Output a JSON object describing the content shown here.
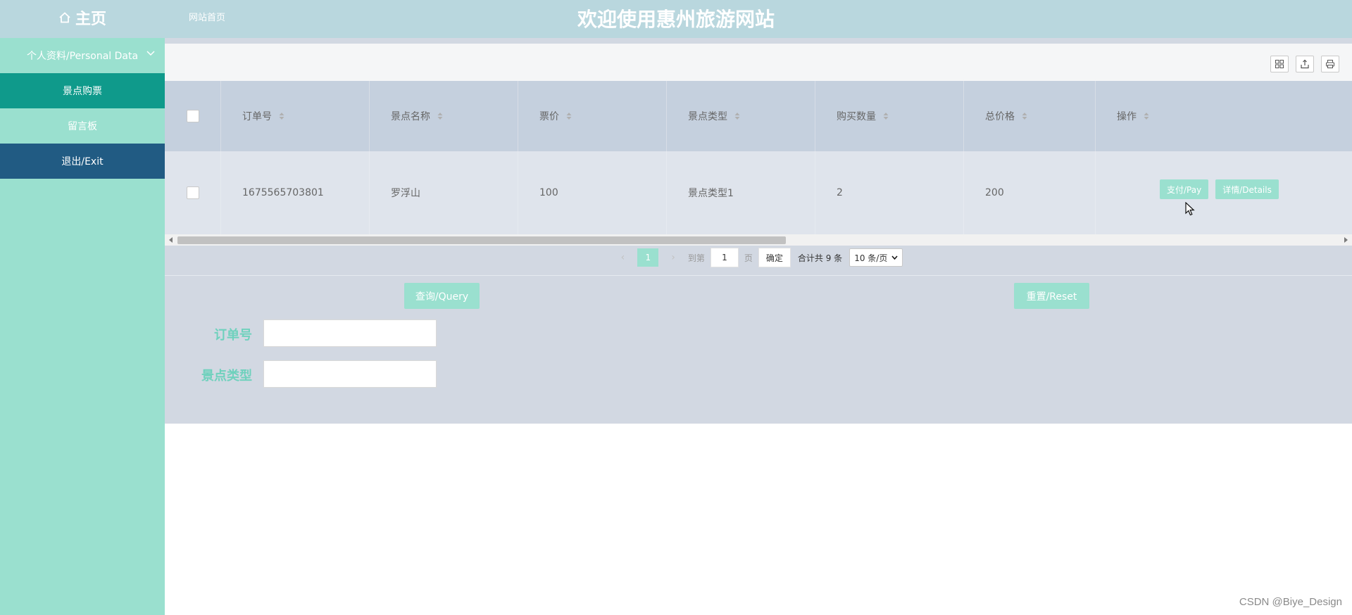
{
  "header": {
    "home_label": "主页",
    "site_link": "网站首页",
    "title": "欢迎使用惠州旅游网站"
  },
  "sidebar": {
    "items": [
      {
        "label": "个人资料/Personal Data"
      },
      {
        "label": "景点购票"
      },
      {
        "label": "留言板"
      },
      {
        "label": "退出/Exit"
      }
    ]
  },
  "table": {
    "columns": [
      "订单号",
      "景点名称",
      "票价",
      "景点类型",
      "购买数量",
      "总价格",
      "操作"
    ],
    "rows": [
      {
        "order_no": "1675565703801",
        "scenic_name": "罗浮山",
        "price": "100",
        "scenic_type": "景点类型1",
        "quantity": "2",
        "total": "200",
        "actions": [
          "支付/Pay",
          "详情/Details"
        ]
      }
    ]
  },
  "pager": {
    "prev": "‹",
    "current_page": "1",
    "next": "›",
    "goto_label": "到第",
    "goto_value": "1",
    "page_label": "页",
    "confirm_label": "确定",
    "total_label": "合计共 9 条",
    "page_size": "10 条/页"
  },
  "search": {
    "query_label": "查询/Query",
    "reset_label": "重置/Reset",
    "fields": [
      {
        "label": "订单号",
        "value": ""
      },
      {
        "label": "景点类型",
        "value": ""
      }
    ]
  },
  "watermark": "CSDN @Biye_Design",
  "colors": {
    "header": "#b9d7de",
    "sidebar": "#9ae0cf",
    "active_item": "#0f9a8b",
    "exit_item": "#215b83",
    "accent": "#9ae0cf",
    "label_green": "#6fd1bd"
  }
}
